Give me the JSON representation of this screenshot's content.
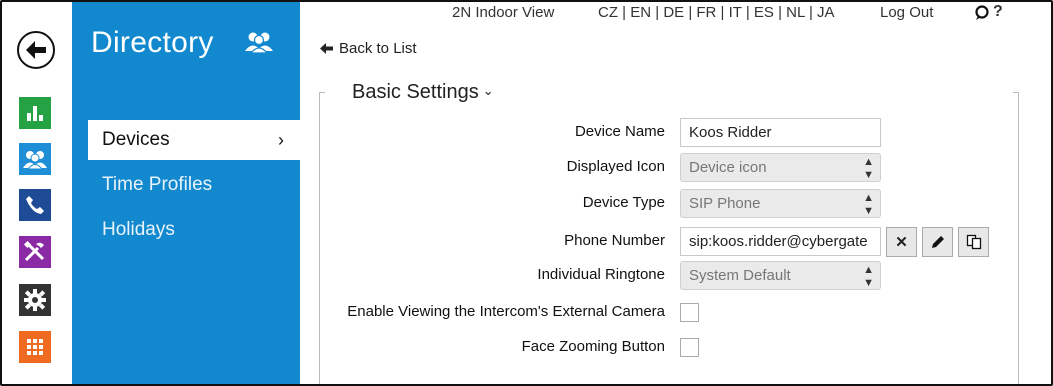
{
  "topbar": {
    "app_name": "2N Indoor View",
    "languages": [
      "CZ",
      "EN",
      "DE",
      "FR",
      "IT",
      "ES",
      "NL",
      "JA"
    ],
    "separator": " | ",
    "logout": "Log Out",
    "help": "?"
  },
  "rail": {
    "icons": [
      "statistics-icon",
      "directory-icon",
      "calls-icon",
      "hardware-icon",
      "system-icon",
      "services-icon"
    ],
    "colors": {
      "statistics": "#25a244",
      "directory": "#1e8fd6",
      "calls": "#1d4b96",
      "hardware": "#8a2ba5",
      "system": "#333333",
      "services": "#ef6b22"
    }
  },
  "sidebar": {
    "title": "Directory",
    "items": [
      {
        "label": "Devices",
        "active": true,
        "chevron": "›"
      },
      {
        "label": "Time Profiles",
        "active": false
      },
      {
        "label": "Holidays",
        "active": false
      }
    ],
    "accent": "#1289cf"
  },
  "main": {
    "back_label": "Back to List",
    "section_title": "Basic Settings",
    "section_caret": "⌄",
    "fields": {
      "device_name": {
        "label": "Device Name",
        "value": "Koos Ridder"
      },
      "displayed_icon": {
        "label": "Displayed Icon",
        "value": "Device icon"
      },
      "device_type": {
        "label": "Device Type",
        "value": "SIP Phone"
      },
      "phone_number": {
        "label": "Phone Number",
        "value": "sip:koos.ridder@cybergate"
      },
      "ringtone": {
        "label": "Individual Ringtone",
        "value": "System Default"
      },
      "external_camera": {
        "label": "Enable Viewing the Intercom's External Camera",
        "checked": false
      },
      "face_zoom": {
        "label": "Face Zooming Button",
        "checked": false
      }
    },
    "phone_buttons": {
      "clear": "✕"
    }
  }
}
